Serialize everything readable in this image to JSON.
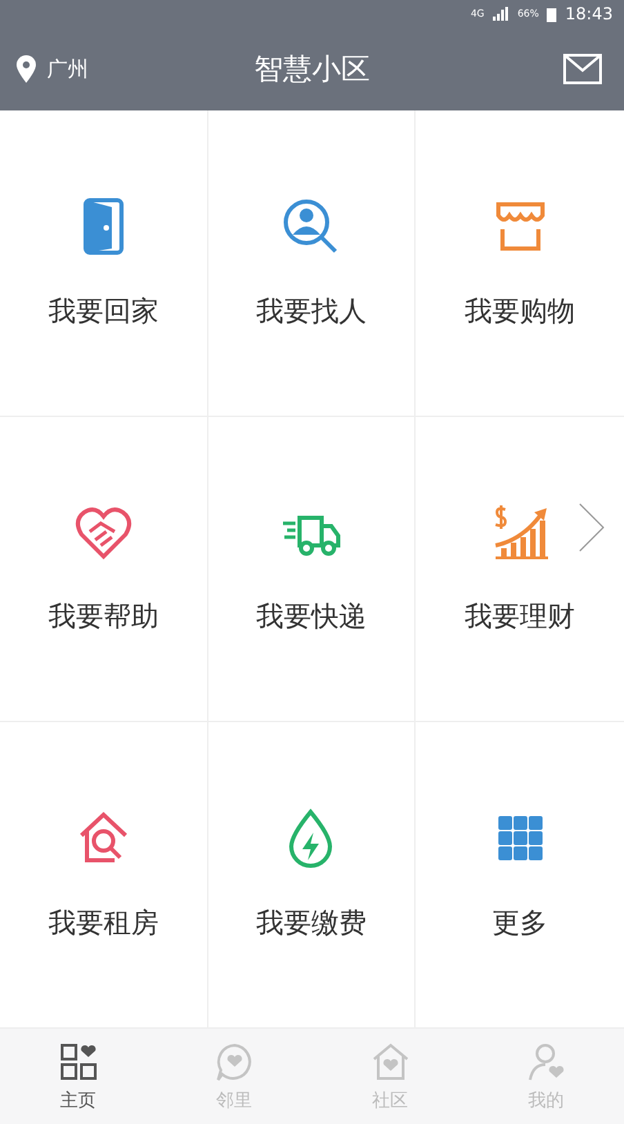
{
  "status_bar": {
    "network": "4G",
    "battery": "66%",
    "time": "18:43"
  },
  "header": {
    "location": "广州",
    "title": "智慧小区"
  },
  "tiles": [
    {
      "label": "我要回家",
      "kind": "door",
      "color": "#3b8fd4"
    },
    {
      "label": "我要找人",
      "kind": "person-search",
      "color": "#3b8fd4"
    },
    {
      "label": "我要购物",
      "kind": "shop",
      "color": "#f08a3a"
    },
    {
      "label": "我要帮助",
      "kind": "handshake",
      "color": "#e8536a"
    },
    {
      "label": "我要快递",
      "kind": "truck",
      "color": "#27b36a"
    },
    {
      "label": "我要理财",
      "kind": "chart",
      "color": "#f08a3a"
    },
    {
      "label": "我要租房",
      "kind": "house-search",
      "color": "#e8536a"
    },
    {
      "label": "我要缴费",
      "kind": "drop",
      "color": "#27b36a"
    },
    {
      "label": "更多",
      "kind": "grid",
      "color": "#3b8fd4"
    }
  ],
  "nav": [
    {
      "label": "主页",
      "kind": "home",
      "selected": true
    },
    {
      "label": "邻里",
      "kind": "chat",
      "selected": false
    },
    {
      "label": "社区",
      "kind": "community",
      "selected": false
    },
    {
      "label": "我的",
      "kind": "user",
      "selected": false
    }
  ]
}
